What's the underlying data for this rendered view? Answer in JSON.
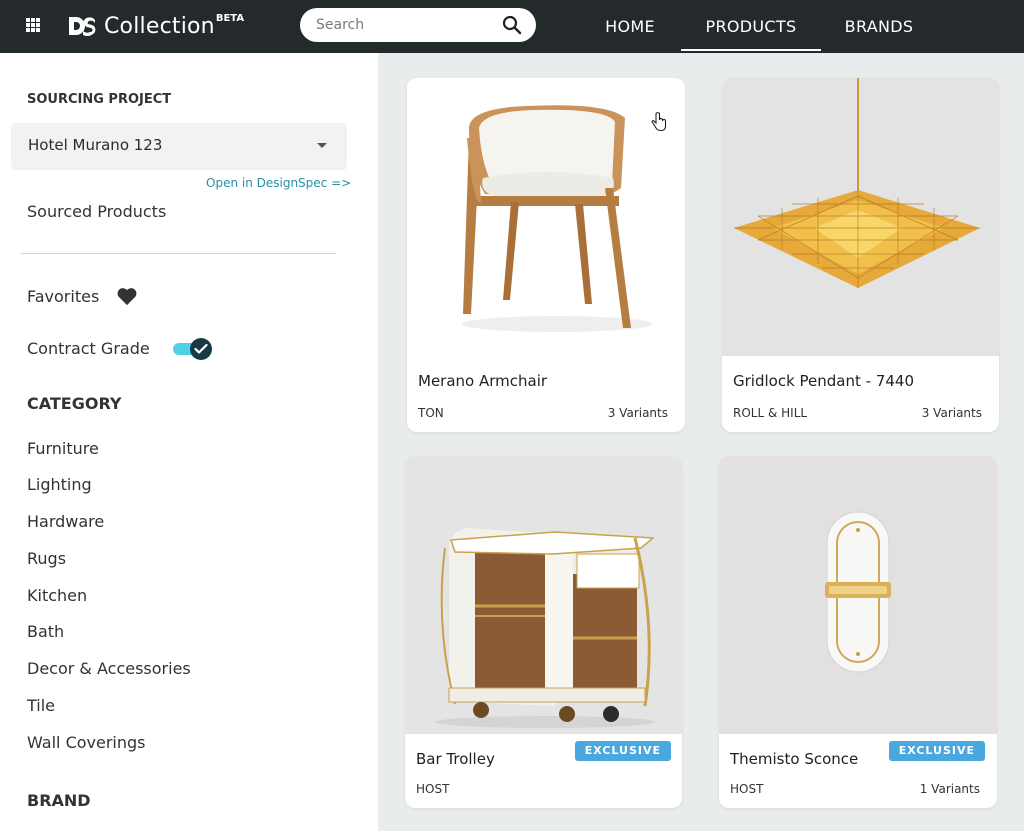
{
  "app": {
    "logo_text": "Collection",
    "logo_badge": "BETA"
  },
  "search": {
    "placeholder": "Search"
  },
  "nav": {
    "home": "HOME",
    "products": "PRODUCTS",
    "brands": "BRANDS"
  },
  "sidebar": {
    "sourcing_heading": "SOURCING PROJECT",
    "project_value": "Hotel Murano 123",
    "open_link": "Open in DesignSpec =>",
    "sourced_products": "Sourced Products",
    "favorites": "Favorites",
    "contract_grade": "Contract Grade",
    "contract_grade_on": true,
    "category_heading": "CATEGORY",
    "categories": [
      "Furniture",
      "Lighting",
      "Hardware",
      "Rugs",
      "Kitchen",
      "Bath",
      "Decor & Accessories",
      "Tile",
      "Wall Coverings"
    ],
    "brand_heading": "BRAND"
  },
  "products": [
    {
      "title": "Merano Armchair",
      "brand": "TON",
      "variants": "3 Variants",
      "badge": ""
    },
    {
      "title": "Gridlock Pendant - 7440",
      "brand": "ROLL & HILL",
      "variants": "3 Variants",
      "badge": ""
    },
    {
      "title": "Bar Trolley",
      "brand": "HOST",
      "variants": "",
      "badge": "EXCLUSIVE"
    },
    {
      "title": "Themisto Sconce",
      "brand": "HOST",
      "variants": "1 Variants",
      "badge": "EXCLUSIVE"
    }
  ],
  "colors": {
    "topbar": "#24292b",
    "accent": "#4fd1e4",
    "badge": "#4aa8de",
    "link": "#2a8fa6"
  }
}
